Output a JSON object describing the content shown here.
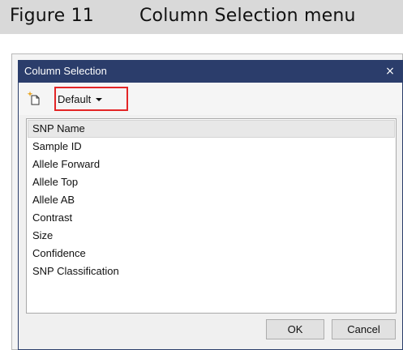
{
  "figure": {
    "number": "Figure 11",
    "title": "Column Selection menu"
  },
  "dialog": {
    "title": "Column Selection",
    "close_label": "×",
    "toolbar": {
      "new_icon": "new-item-icon",
      "dropdown_value": "Default"
    },
    "columns": [
      "SNP Name",
      "Sample ID",
      "Allele Forward",
      "Allele Top",
      "Allele AB",
      "Contrast",
      "Size",
      "Confidence",
      "SNP Classification"
    ],
    "selected_index": 0,
    "buttons": {
      "ok": "OK",
      "cancel": "Cancel"
    }
  },
  "colors": {
    "titlebar": "#2b3d6b",
    "highlight_box": "#e32526",
    "caption_band": "#d9d9d9"
  }
}
